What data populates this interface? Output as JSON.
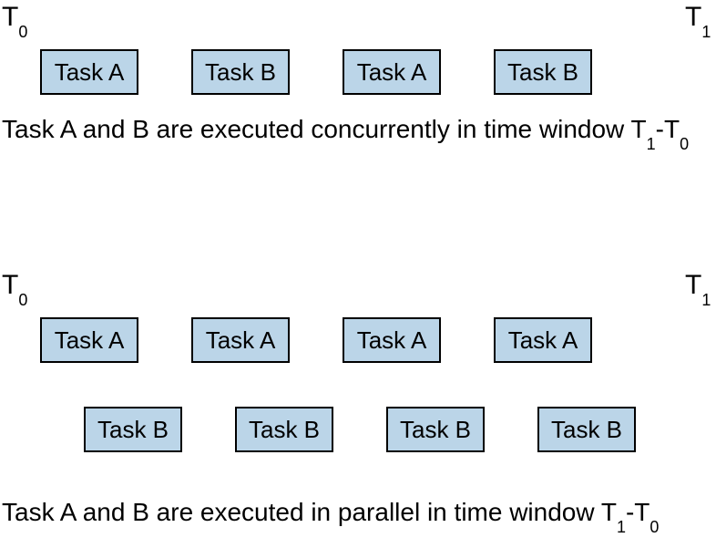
{
  "labels": {
    "T0_main": "T",
    "T0_sub": "0",
    "T1_main": "T",
    "T1_sub": "1"
  },
  "top": {
    "tasks": [
      "Task A",
      "Task B",
      "Task A",
      "Task B"
    ],
    "caption_pre": "Task A and B are executed concurrently in time window T",
    "caption_sub1": "1",
    "caption_mid": "-T",
    "caption_sub2": "0"
  },
  "bottom": {
    "rowA": [
      "Task A",
      "Task A",
      "Task A",
      "Task A"
    ],
    "rowB": [
      "Task B",
      "Task B",
      "Task B",
      "Task B"
    ],
    "caption_pre": "Task A and B are executed in parallel in time window T",
    "caption_sub1": "1",
    "caption_mid": "-T",
    "caption_sub2": "0"
  }
}
